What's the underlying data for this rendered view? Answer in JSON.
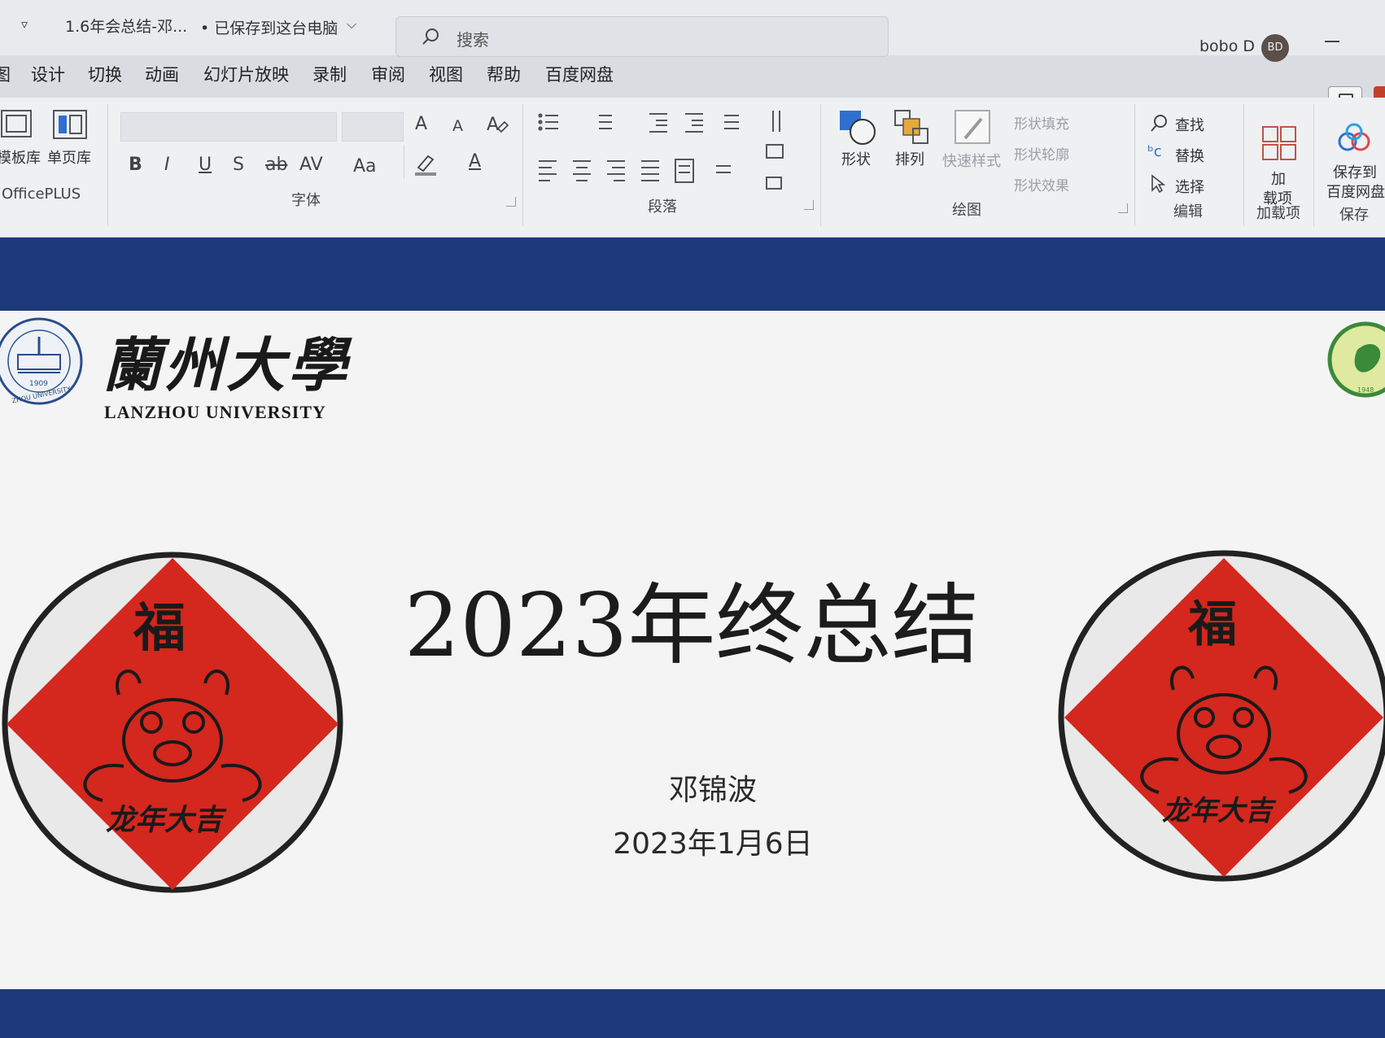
{
  "titlebar": {
    "doc_title": "1.6年会总结-邓...",
    "save_status": "• 已保存到这台电脑",
    "search_placeholder": "搜索",
    "user_name": "bobo D",
    "avatar_initials": "BD"
  },
  "tabs": [
    {
      "label": "图"
    },
    {
      "label": "设计"
    },
    {
      "label": "切换"
    },
    {
      "label": "动画"
    },
    {
      "label": "幻灯片放映"
    },
    {
      "label": "录制"
    },
    {
      "label": "审阅"
    },
    {
      "label": "视图"
    },
    {
      "label": "帮助"
    },
    {
      "label": "百度网盘"
    }
  ],
  "ribbon": {
    "officeplus": {
      "template_lib": "模板库",
      "page_lib": "单页库",
      "group": "OfficePLUS"
    },
    "font": {
      "group": "字体",
      "bold": "B",
      "italic": "I",
      "underline": "U",
      "shadow": "S",
      "strike": "ab",
      "spacing": "AV",
      "case": "Aa",
      "grow": "A",
      "shrink": "A",
      "font_color": "A"
    },
    "paragraph": {
      "group": "段落"
    },
    "drawing": {
      "group": "绘图",
      "shape": "形状",
      "arrange": "排列",
      "quick_styles": "快速样式",
      "shape_fill": "形状填充",
      "shape_outline": "形状轮廓",
      "shape_effects": "形状效果"
    },
    "editing": {
      "group": "编辑",
      "find": "查找",
      "replace": "替换",
      "select": "选择"
    },
    "addins": {
      "group": "加载项",
      "button_line1": "加",
      "button_line2": "载项"
    },
    "save": {
      "group": "保存",
      "button_line1": "保存到",
      "button_line2": "百度网盘"
    }
  },
  "slide": {
    "university_cn": "蘭州大學",
    "university_en": "LANZHOU UNIVERSITY",
    "seal_year": "1909",
    "seal_ring_text": "ZHOU UNIVERSITY",
    "title": "2023年终总结",
    "author": "邓锦波",
    "date": "2023年1月6日",
    "badge_top": "福",
    "badge_bottom": "龙年大吉",
    "right_seal_year": "1948"
  },
  "colors": {
    "slide_background_band": "#1f3a7a",
    "badge_red": "#d4271e",
    "ribbon_bg": "#eef0f2"
  }
}
